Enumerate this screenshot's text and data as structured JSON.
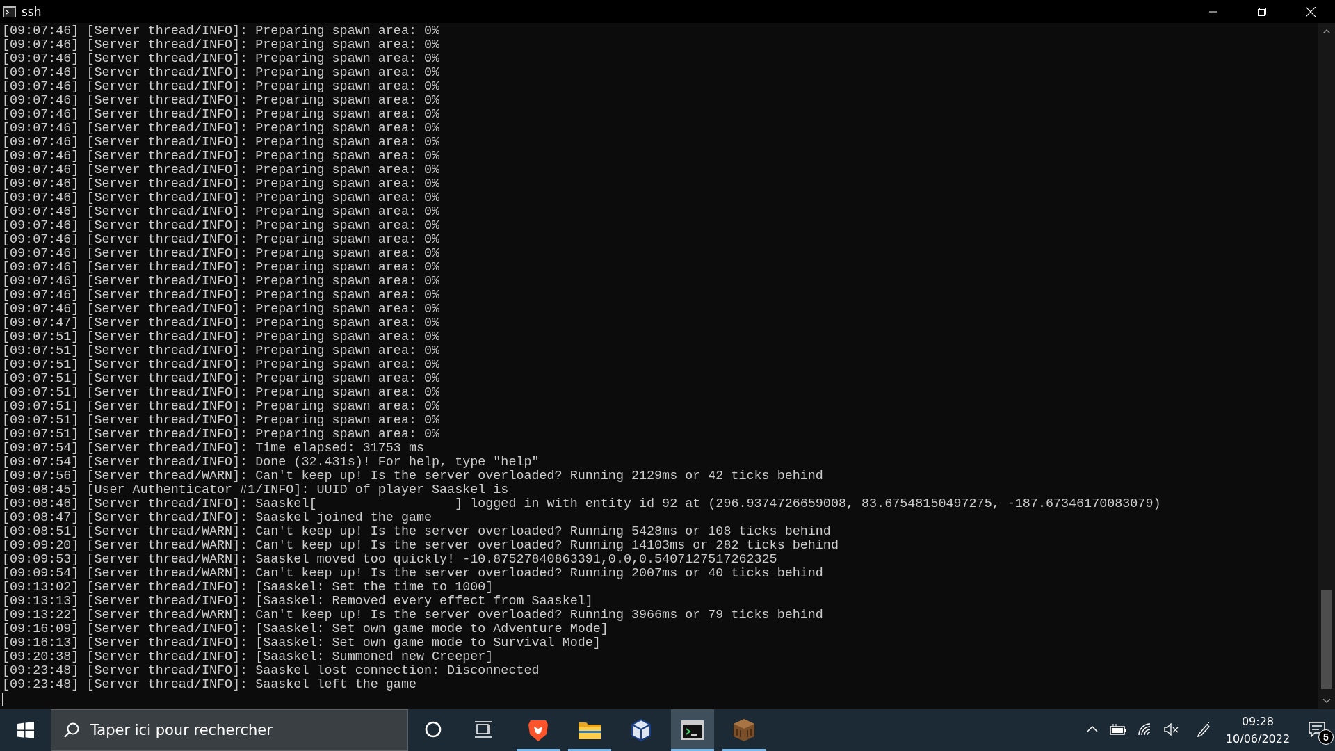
{
  "window": {
    "title": "ssh"
  },
  "terminal_lines": [
    "[09:07:46] [Server thread/INFO]: Preparing spawn area: 0%",
    "[09:07:46] [Server thread/INFO]: Preparing spawn area: 0%",
    "[09:07:46] [Server thread/INFO]: Preparing spawn area: 0%",
    "[09:07:46] [Server thread/INFO]: Preparing spawn area: 0%",
    "[09:07:46] [Server thread/INFO]: Preparing spawn area: 0%",
    "[09:07:46] [Server thread/INFO]: Preparing spawn area: 0%",
    "[09:07:46] [Server thread/INFO]: Preparing spawn area: 0%",
    "[09:07:46] [Server thread/INFO]: Preparing spawn area: 0%",
    "[09:07:46] [Server thread/INFO]: Preparing spawn area: 0%",
    "[09:07:46] [Server thread/INFO]: Preparing spawn area: 0%",
    "[09:07:46] [Server thread/INFO]: Preparing spawn area: 0%",
    "[09:07:46] [Server thread/INFO]: Preparing spawn area: 0%",
    "[09:07:46] [Server thread/INFO]: Preparing spawn area: 0%",
    "[09:07:46] [Server thread/INFO]: Preparing spawn area: 0%",
    "[09:07:46] [Server thread/INFO]: Preparing spawn area: 0%",
    "[09:07:46] [Server thread/INFO]: Preparing spawn area: 0%",
    "[09:07:46] [Server thread/INFO]: Preparing spawn area: 0%",
    "[09:07:46] [Server thread/INFO]: Preparing spawn area: 0%",
    "[09:07:46] [Server thread/INFO]: Preparing spawn area: 0%",
    "[09:07:46] [Server thread/INFO]: Preparing spawn area: 0%",
    "[09:07:46] [Server thread/INFO]: Preparing spawn area: 0%",
    "[09:07:47] [Server thread/INFO]: Preparing spawn area: 0%",
    "[09:07:51] [Server thread/INFO]: Preparing spawn area: 0%",
    "[09:07:51] [Server thread/INFO]: Preparing spawn area: 0%",
    "[09:07:51] [Server thread/INFO]: Preparing spawn area: 0%",
    "[09:07:51] [Server thread/INFO]: Preparing spawn area: 0%",
    "[09:07:51] [Server thread/INFO]: Preparing spawn area: 0%",
    "[09:07:51] [Server thread/INFO]: Preparing spawn area: 0%",
    "[09:07:51] [Server thread/INFO]: Preparing spawn area: 0%",
    "[09:07:51] [Server thread/INFO]: Preparing spawn area: 0%",
    "[09:07:54] [Server thread/INFO]: Time elapsed: 31753 ms",
    "[09:07:54] [Server thread/INFO]: Done (32.431s)! For help, type \"help\"",
    "[09:07:56] [Server thread/WARN]: Can't keep up! Is the server overloaded? Running 2129ms or 42 ticks behind",
    "[09:08:45] [User Authenticator #1/INFO]: UUID of player Saaskel is",
    "[09:08:46] [Server thread/INFO]: Saaskel[                  ] logged in with entity id 92 at (296.9374726659008, 83.67548150497275, -187.67346170083079)",
    "[09:08:47] [Server thread/INFO]: Saaskel joined the game",
    "[09:08:51] [Server thread/WARN]: Can't keep up! Is the server overloaded? Running 5428ms or 108 ticks behind",
    "[09:09:20] [Server thread/WARN]: Can't keep up! Is the server overloaded? Running 14103ms or 282 ticks behind",
    "[09:09:53] [Server thread/WARN]: Saaskel moved too quickly! -10.87527840863391,0.0,0.5407127517262325",
    "[09:09:54] [Server thread/WARN]: Can't keep up! Is the server overloaded? Running 2007ms or 40 ticks behind",
    "[09:13:02] [Server thread/INFO]: [Saaskel: Set the time to 1000]",
    "[09:13:13] [Server thread/INFO]: [Saaskel: Removed every effect from Saaskel]",
    "[09:13:22] [Server thread/WARN]: Can't keep up! Is the server overloaded? Running 3966ms or 79 ticks behind",
    "[09:16:09] [Server thread/INFO]: [Saaskel: Set own game mode to Adventure Mode]",
    "[09:16:13] [Server thread/INFO]: [Saaskel: Set own game mode to Survival Mode]",
    "[09:20:38] [Server thread/INFO]: [Saaskel: Summoned new Creeper]",
    "[09:23:48] [Server thread/INFO]: Saaskel lost connection: Disconnected",
    "[09:23:48] [Server thread/INFO]: Saaskel left the game"
  ],
  "taskbar": {
    "search": {
      "placeholder": "Taper ici pour rechercher"
    },
    "apps": [
      {
        "kind": "browser",
        "running": true,
        "active": false
      },
      {
        "kind": "folder",
        "running": true,
        "active": false
      },
      {
        "kind": "cube",
        "running": false,
        "active": false
      },
      {
        "kind": "terminal",
        "running": true,
        "active": true
      },
      {
        "kind": "block",
        "running": true,
        "active": false
      }
    ],
    "clock": {
      "time": "09:28",
      "date": "10/06/2022"
    },
    "notifications": {
      "count": "5"
    }
  }
}
